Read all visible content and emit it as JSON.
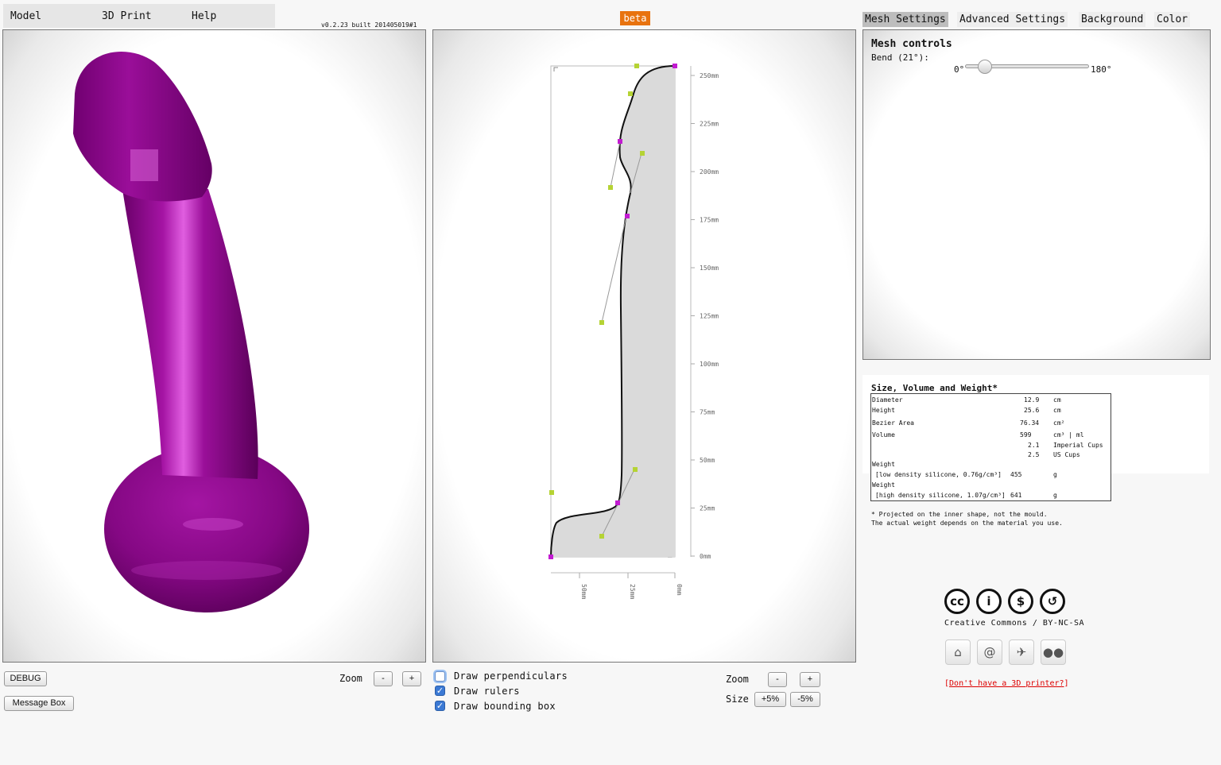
{
  "menu": {
    "model": "Model",
    "print": "3D Print",
    "help": "Help"
  },
  "version": "v0.2.23 built 20140501​9#1",
  "beta": "beta",
  "tabs": [
    "Mesh Settings",
    "Advanced Settings",
    "Background",
    "Color"
  ],
  "mesh": {
    "title": "Mesh controls",
    "bend_label": "Bend (21°):",
    "slider_min": "0°",
    "slider_max": "180°",
    "bend_value_degrees": 21
  },
  "info": {
    "title": "Size, Volume and Weight*",
    "rows": {
      "diameter": {
        "label": "Diameter",
        "value": "12.9",
        "unit": "cm"
      },
      "height": {
        "label": "Height",
        "value": "25.6",
        "unit": "cm"
      },
      "area": {
        "label": "Bezier Area",
        "value": "76.34",
        "unit": "cm²"
      },
      "volume": {
        "label": "Volume",
        "value": "599",
        "unit": "cm³ | ml"
      },
      "imperial": {
        "value": "2.1",
        "unit": "Imperial Cups"
      },
      "us": {
        "value": "2.5",
        "unit": "US Cups"
      },
      "weight_low": {
        "label": "Weight",
        "desc": "[low density silicone, 0.76g/cm³]",
        "value": "455",
        "unit": "g"
      },
      "weight_high": {
        "label": "Weight",
        "desc": "[high density silicone, 1.07g/cm³]",
        "value": "641",
        "unit": "g"
      }
    },
    "footnote1": "* Projected on the inner shape, not the mould.",
    "footnote2": "The actual weight depends on the material you use."
  },
  "cc": {
    "icons": [
      "cc-icon",
      "by-icon",
      "nc-icon",
      "sa-icon"
    ],
    "text": "Creative Commons / BY-NC-SA"
  },
  "social": [
    "github-icon",
    "email-icon",
    "twitter-icon",
    "flickr-icon"
  ],
  "printer_link": "Don't have a 3D printer?",
  "left_controls": {
    "debug": "DEBUG",
    "message_box": "Message Box",
    "zoom": "Zoom",
    "minus": "-",
    "plus": "+"
  },
  "mid_controls": {
    "draw_perpendiculars": "Draw perpendiculars",
    "draw_rulers": "Draw rulers",
    "draw_bounding_box": "Draw bounding box",
    "perpendiculars_checked": false,
    "rulers_checked": true,
    "bounding_box_checked": true,
    "zoom": "Zoom",
    "minus": "-",
    "plus": "+",
    "size": "Size",
    "plus5": "+5%",
    "minus5": "-5%"
  },
  "ruler": {
    "y_ticks": [
      "250mm",
      "225mm",
      "200mm",
      "175mm",
      "150mm",
      "125mm",
      "100mm",
      "75mm",
      "50mm",
      "25mm",
      "0mm"
    ],
    "x_ticks": [
      "50mm",
      "25mm",
      "0mm"
    ]
  },
  "colors": {
    "model": "#8b0b8b",
    "beta": "#e8730f",
    "control_point": "#b5d334",
    "anchor_point": "#c21bd1",
    "shape_fill": "#dadada",
    "link": "#dd0000"
  }
}
